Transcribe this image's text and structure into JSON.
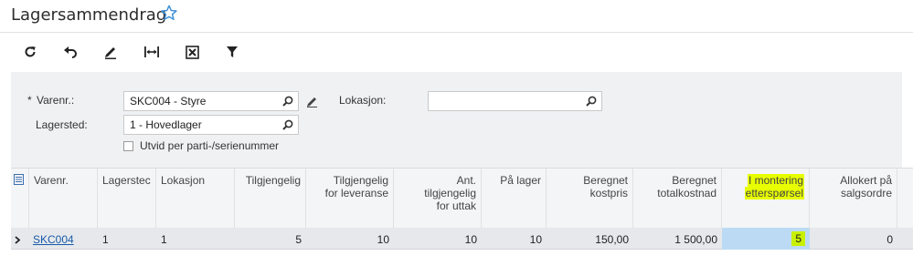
{
  "header": {
    "title": "Lagersammendrag"
  },
  "icons": {
    "favorite": "star-icon",
    "refresh": "refresh-icon",
    "undo": "undo-icon",
    "edit": "pencil-icon",
    "fit": "fit-width-icon",
    "export": "export-excel-icon",
    "filter": "filter-icon",
    "search": "search-icon",
    "column_chooser": "column-chooser-icon",
    "row_selector": "chevron-right-icon"
  },
  "filters": {
    "inventory_label": "Varenr.:",
    "inventory_required": "*",
    "inventory_value": "SKC004 - Styre",
    "warehouse_label": "Lagersted:",
    "warehouse_value": "1 - Hovedlager",
    "location_label": "Lokasjon:",
    "location_value": "",
    "expand_label": "Utvid per parti-/serienummer"
  },
  "grid": {
    "columns": [
      {
        "line1": "Varenr.",
        "line2": "",
        "line3": ""
      },
      {
        "line1": "Lagerstec",
        "line2": "",
        "line3": ""
      },
      {
        "line1": "Lokasjon",
        "line2": "",
        "line3": ""
      },
      {
        "line1": "Tilgjengelig",
        "line2": "",
        "line3": ""
      },
      {
        "line1": "Tilgjengelig",
        "line2": "for leveranse",
        "line3": ""
      },
      {
        "line1": "Ant.",
        "line2": "tilgjengelig",
        "line3": "for uttak"
      },
      {
        "line1": "På lager",
        "line2": "",
        "line3": ""
      },
      {
        "line1": "Beregnet",
        "line2": "kostpris",
        "line3": ""
      },
      {
        "line1": "Beregnet",
        "line2": "totalkostnad",
        "line3": ""
      },
      {
        "line1": "I montering",
        "line2": "etterspørsel",
        "line3": ""
      },
      {
        "line1": "Allokert på",
        "line2": "salgsordre",
        "line3": ""
      }
    ],
    "rows": [
      {
        "item": "SKC004",
        "warehouse": "1",
        "location": "1",
        "available": "5",
        "available_shipment": "10",
        "qty_available_issue": "10",
        "on_hand": "10",
        "est_cost": "150,00",
        "est_total_cost": "1 500,00",
        "in_assembly_demand": "5",
        "allocated_so": "0"
      }
    ]
  },
  "colors": {
    "highlight": "#e8ff00",
    "link": "#1a5aa8",
    "selected_cell": "#bcdaf3",
    "star": "#3d8fd8"
  }
}
